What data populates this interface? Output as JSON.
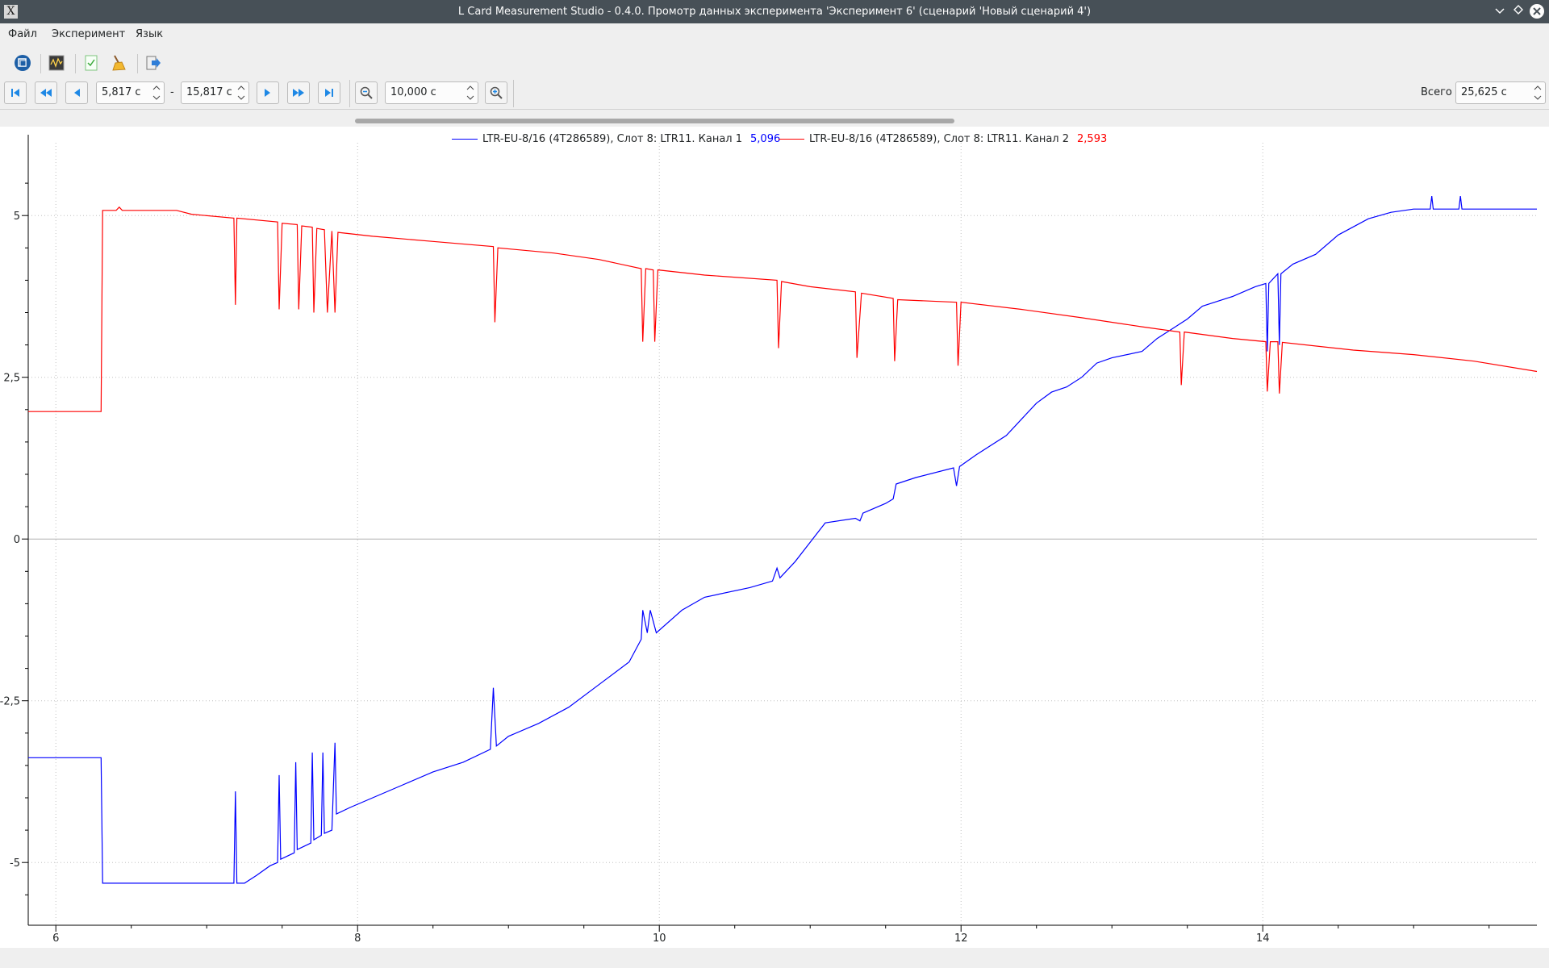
{
  "window": {
    "title": "L Card Measurement Studio - 0.4.0. Промотр данных эксперимента 'Эксперимент 6' (сценарий 'Новый сценарий 4')"
  },
  "menu": {
    "file": "Файл",
    "experiment": "Эксперимент",
    "language": "Язык"
  },
  "toolbar": {
    "icons": [
      "device-icon",
      "waveform-icon",
      "check-document-icon",
      "broom-icon",
      "export-icon"
    ]
  },
  "navigation": {
    "range_start": "5,817 с",
    "range_sep": "-",
    "range_end": "15,817 с",
    "window_size": "10,000 с",
    "total_label": "Всего",
    "total_value": "25,625 с"
  },
  "colors": {
    "channel1": "#0000ff",
    "channel2": "#ff0000",
    "axis": "#000000",
    "grid": "#c0c0c0"
  },
  "chart_data": {
    "type": "line",
    "title": "",
    "xlabel": "",
    "ylabel": "",
    "xlim": [
      5.817,
      15.817
    ],
    "ylim": [
      -5.97,
      6.0
    ],
    "x_ticks": [
      6,
      8,
      10,
      12,
      14
    ],
    "x_tick_labels": [
      "6",
      "8",
      "10",
      "12",
      "14"
    ],
    "y_ticks": [
      5,
      2.5,
      0,
      -2.5,
      -5
    ],
    "y_tick_labels": [
      "5",
      "2,5",
      "0",
      "-2,5",
      "-5"
    ],
    "grid": true,
    "legend_position": "top-center",
    "series": [
      {
        "name": "LTR-EU-8/16 (4T286589), Слот  8: LTR11. Канал 1",
        "current_value": "5,096",
        "color": "#0000ff",
        "points": [
          [
            5.817,
            -3.38
          ],
          [
            6.3,
            -3.38
          ],
          [
            6.31,
            -5.32
          ],
          [
            7.18,
            -5.32
          ],
          [
            7.19,
            -3.9
          ],
          [
            7.2,
            -5.32
          ],
          [
            7.25,
            -5.32
          ],
          [
            7.33,
            -5.2
          ],
          [
            7.42,
            -5.05
          ],
          [
            7.47,
            -5.0
          ],
          [
            7.48,
            -3.65
          ],
          [
            7.49,
            -4.95
          ],
          [
            7.58,
            -4.85
          ],
          [
            7.59,
            -3.45
          ],
          [
            7.6,
            -4.8
          ],
          [
            7.69,
            -4.7
          ],
          [
            7.7,
            -3.3
          ],
          [
            7.71,
            -4.65
          ],
          [
            7.76,
            -4.58
          ],
          [
            7.77,
            -3.3
          ],
          [
            7.78,
            -4.55
          ],
          [
            7.83,
            -4.5
          ],
          [
            7.85,
            -3.15
          ],
          [
            7.86,
            -4.25
          ],
          [
            7.95,
            -4.15
          ],
          [
            8.1,
            -4.0
          ],
          [
            8.3,
            -3.8
          ],
          [
            8.5,
            -3.6
          ],
          [
            8.7,
            -3.45
          ],
          [
            8.88,
            -3.25
          ],
          [
            8.9,
            -2.3
          ],
          [
            8.92,
            -3.2
          ],
          [
            9.0,
            -3.05
          ],
          [
            9.2,
            -2.85
          ],
          [
            9.4,
            -2.6
          ],
          [
            9.6,
            -2.25
          ],
          [
            9.8,
            -1.9
          ],
          [
            9.88,
            -1.55
          ],
          [
            9.89,
            -1.1
          ],
          [
            9.92,
            -1.45
          ],
          [
            9.94,
            -1.1
          ],
          [
            9.98,
            -1.45
          ],
          [
            10.15,
            -1.1
          ],
          [
            10.3,
            -0.9
          ],
          [
            10.6,
            -0.75
          ],
          [
            10.75,
            -0.65
          ],
          [
            10.78,
            -0.45
          ],
          [
            10.8,
            -0.6
          ],
          [
            10.9,
            -0.35
          ],
          [
            11.0,
            -0.05
          ],
          [
            11.1,
            0.25
          ],
          [
            11.3,
            0.32
          ],
          [
            11.33,
            0.28
          ],
          [
            11.35,
            0.4
          ],
          [
            11.5,
            0.55
          ],
          [
            11.55,
            0.62
          ],
          [
            11.57,
            0.85
          ],
          [
            11.7,
            0.95
          ],
          [
            11.95,
            1.1
          ],
          [
            11.97,
            0.82
          ],
          [
            11.99,
            1.12
          ],
          [
            12.1,
            1.3
          ],
          [
            12.3,
            1.6
          ],
          [
            12.4,
            1.85
          ],
          [
            12.5,
            2.1
          ],
          [
            12.6,
            2.27
          ],
          [
            12.7,
            2.35
          ],
          [
            12.8,
            2.5
          ],
          [
            12.9,
            2.72
          ],
          [
            13.0,
            2.8
          ],
          [
            13.2,
            2.9
          ],
          [
            13.3,
            3.1
          ],
          [
            13.4,
            3.25
          ],
          [
            13.5,
            3.4
          ],
          [
            13.6,
            3.6
          ],
          [
            13.8,
            3.75
          ],
          [
            13.95,
            3.9
          ],
          [
            14.02,
            3.95
          ],
          [
            14.03,
            2.9
          ],
          [
            14.04,
            3.95
          ],
          [
            14.1,
            4.1
          ],
          [
            14.11,
            3.0
          ],
          [
            14.12,
            4.1
          ],
          [
            14.2,
            4.25
          ],
          [
            14.35,
            4.4
          ],
          [
            14.5,
            4.7
          ],
          [
            14.7,
            4.95
          ],
          [
            14.85,
            5.05
          ],
          [
            15.0,
            5.1
          ],
          [
            15.11,
            5.1
          ],
          [
            15.12,
            5.3
          ],
          [
            15.13,
            5.1
          ],
          [
            15.3,
            5.1
          ],
          [
            15.31,
            5.3
          ],
          [
            15.32,
            5.1
          ],
          [
            15.817,
            5.1
          ]
        ]
      },
      {
        "name": "LTR-EU-8/16 (4T286589), Слот  8: LTR11. Канал 2",
        "current_value": "2,593",
        "color": "#ff0000",
        "points": [
          [
            5.817,
            1.97
          ],
          [
            6.3,
            1.97
          ],
          [
            6.31,
            5.08
          ],
          [
            6.4,
            5.08
          ],
          [
            6.42,
            5.13
          ],
          [
            6.44,
            5.08
          ],
          [
            6.8,
            5.08
          ],
          [
            6.9,
            5.02
          ],
          [
            7.18,
            4.96
          ],
          [
            7.19,
            3.62
          ],
          [
            7.2,
            4.96
          ],
          [
            7.47,
            4.9
          ],
          [
            7.48,
            3.55
          ],
          [
            7.5,
            4.88
          ],
          [
            7.6,
            4.86
          ],
          [
            7.61,
            3.55
          ],
          [
            7.63,
            4.84
          ],
          [
            7.7,
            4.82
          ],
          [
            7.71,
            3.5
          ],
          [
            7.73,
            4.8
          ],
          [
            7.78,
            4.78
          ],
          [
            7.8,
            3.5
          ],
          [
            7.83,
            4.76
          ],
          [
            7.85,
            3.5
          ],
          [
            7.87,
            4.74
          ],
          [
            8.1,
            4.68
          ],
          [
            8.5,
            4.6
          ],
          [
            8.9,
            4.52
          ],
          [
            8.91,
            3.35
          ],
          [
            8.93,
            4.5
          ],
          [
            9.3,
            4.42
          ],
          [
            9.6,
            4.32
          ],
          [
            9.88,
            4.18
          ],
          [
            9.89,
            3.05
          ],
          [
            9.91,
            4.18
          ],
          [
            9.96,
            4.16
          ],
          [
            9.97,
            3.05
          ],
          [
            9.99,
            4.16
          ],
          [
            10.3,
            4.08
          ],
          [
            10.78,
            4.0
          ],
          [
            10.79,
            2.95
          ],
          [
            10.81,
            3.98
          ],
          [
            11.0,
            3.9
          ],
          [
            11.3,
            3.82
          ],
          [
            11.31,
            2.8
          ],
          [
            11.34,
            3.8
          ],
          [
            11.55,
            3.72
          ],
          [
            11.56,
            2.75
          ],
          [
            11.58,
            3.7
          ],
          [
            11.97,
            3.66
          ],
          [
            11.98,
            2.68
          ],
          [
            12.0,
            3.66
          ],
          [
            12.4,
            3.55
          ],
          [
            12.8,
            3.42
          ],
          [
            13.2,
            3.28
          ],
          [
            13.45,
            3.2
          ],
          [
            13.46,
            2.38
          ],
          [
            13.48,
            3.2
          ],
          [
            13.8,
            3.1
          ],
          [
            14.02,
            3.05
          ],
          [
            14.03,
            2.28
          ],
          [
            14.05,
            3.05
          ],
          [
            14.1,
            3.05
          ],
          [
            14.11,
            2.25
          ],
          [
            14.13,
            3.04
          ],
          [
            14.6,
            2.92
          ],
          [
            15.0,
            2.85
          ],
          [
            15.4,
            2.75
          ],
          [
            15.817,
            2.59
          ]
        ]
      }
    ]
  }
}
